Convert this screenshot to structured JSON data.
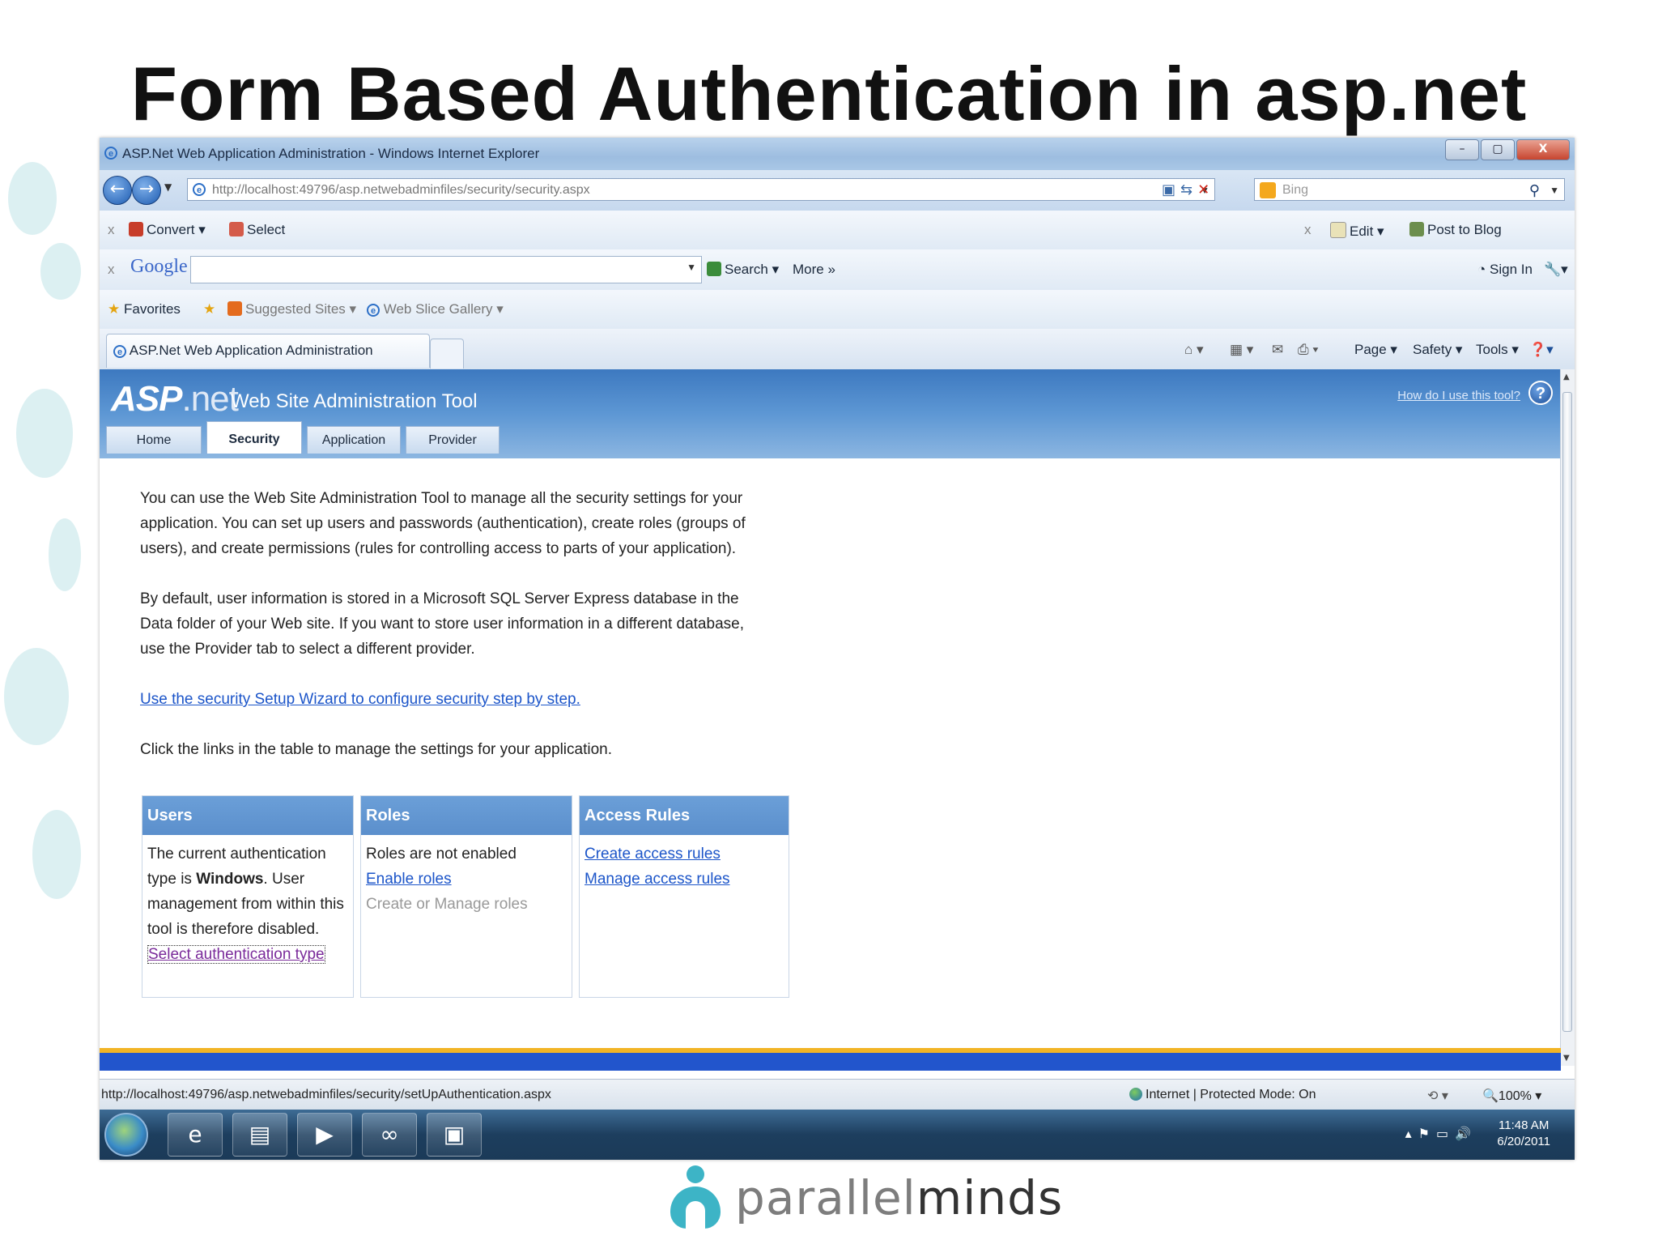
{
  "slide": {
    "title": "Form Based Authentication in asp.net"
  },
  "window": {
    "title": "ASP.Net Web Application Administration - Windows Internet Explorer",
    "address": "http://localhost:49796/asp.netwebadminfiles/security/security.aspx",
    "search_placeholder": "Bing"
  },
  "toolbar1": {
    "convert": "Convert",
    "select": "Select",
    "edit": "Edit",
    "post_to_blog": "Post to Blog"
  },
  "google_bar": {
    "logo": "Google",
    "search": "Search",
    "more": "More »",
    "sign_in": "Sign In"
  },
  "favorites_bar": {
    "favorites": "Favorites",
    "suggested_sites": "Suggested Sites",
    "web_slice_gallery": "Web Slice Gallery"
  },
  "tab": {
    "label": "ASP.Net Web Application Administration"
  },
  "command_bar": {
    "page": "Page",
    "safety": "Safety",
    "tools": "Tools"
  },
  "asp": {
    "logo_asp": "ASP",
    "logo_net": ".net",
    "tool_title": "Web Site Administration Tool",
    "how_link": "How do I use this tool?",
    "tabs": [
      "Home",
      "Security",
      "Application",
      "Provider"
    ],
    "active_tab": "Security"
  },
  "content": {
    "para1": "You can use the Web Site Administration Tool to manage all the security settings for your application. You can set up users and passwords (authentication), create roles (groups of users), and create permissions (rules for controlling access to parts of your application).",
    "para2": "By default, user information is stored in a Microsoft SQL Server Express database in the Data folder of your Web site. If you want to store user information in a different database, use the Provider tab to select a different provider.",
    "wizard_link": "Use the security Setup Wizard to configure security step by step.",
    "table_intro": "Click the links in the table to manage the settings for your application."
  },
  "table": {
    "users": {
      "header": "Users",
      "text_before": "The current authentication type is ",
      "auth_type": "Windows",
      "text_after": ". User management from within this tool is therefore disabled.",
      "link": "Select authentication type"
    },
    "roles": {
      "header": "Roles",
      "status": "Roles are not enabled",
      "enable_link": "Enable roles",
      "manage_disabled": "Create or Manage roles"
    },
    "access": {
      "header": "Access Rules",
      "create_link": "Create access rules",
      "manage_link": "Manage access rules"
    }
  },
  "status_bar": {
    "url": "http://localhost:49796/asp.netwebadminfiles/security/setUpAuthentication.aspx",
    "zone": "Internet | Protected Mode: On",
    "zoom": "100%"
  },
  "taskbar": {
    "time": "11:48 AM",
    "date": "6/20/2011"
  },
  "footer": {
    "brand_light": "parallel",
    "brand_dark": "minds"
  }
}
